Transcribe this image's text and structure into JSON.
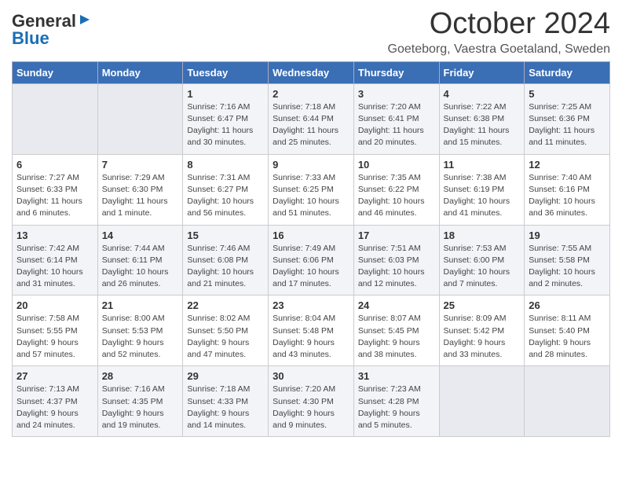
{
  "header": {
    "logo_general": "General",
    "logo_blue": "Blue",
    "title": "October 2024",
    "subtitle": "Goeteborg, Vaestra Goetaland, Sweden"
  },
  "days_of_week": [
    "Sunday",
    "Monday",
    "Tuesday",
    "Wednesday",
    "Thursday",
    "Friday",
    "Saturday"
  ],
  "weeks": [
    [
      {
        "day": "",
        "info": ""
      },
      {
        "day": "",
        "info": ""
      },
      {
        "day": "1",
        "info": "Sunrise: 7:16 AM\nSunset: 6:47 PM\nDaylight: 11 hours and 30 minutes."
      },
      {
        "day": "2",
        "info": "Sunrise: 7:18 AM\nSunset: 6:44 PM\nDaylight: 11 hours and 25 minutes."
      },
      {
        "day": "3",
        "info": "Sunrise: 7:20 AM\nSunset: 6:41 PM\nDaylight: 11 hours and 20 minutes."
      },
      {
        "day": "4",
        "info": "Sunrise: 7:22 AM\nSunset: 6:38 PM\nDaylight: 11 hours and 15 minutes."
      },
      {
        "day": "5",
        "info": "Sunrise: 7:25 AM\nSunset: 6:36 PM\nDaylight: 11 hours and 11 minutes."
      }
    ],
    [
      {
        "day": "6",
        "info": "Sunrise: 7:27 AM\nSunset: 6:33 PM\nDaylight: 11 hours and 6 minutes."
      },
      {
        "day": "7",
        "info": "Sunrise: 7:29 AM\nSunset: 6:30 PM\nDaylight: 11 hours and 1 minute."
      },
      {
        "day": "8",
        "info": "Sunrise: 7:31 AM\nSunset: 6:27 PM\nDaylight: 10 hours and 56 minutes."
      },
      {
        "day": "9",
        "info": "Sunrise: 7:33 AM\nSunset: 6:25 PM\nDaylight: 10 hours and 51 minutes."
      },
      {
        "day": "10",
        "info": "Sunrise: 7:35 AM\nSunset: 6:22 PM\nDaylight: 10 hours and 46 minutes."
      },
      {
        "day": "11",
        "info": "Sunrise: 7:38 AM\nSunset: 6:19 PM\nDaylight: 10 hours and 41 minutes."
      },
      {
        "day": "12",
        "info": "Sunrise: 7:40 AM\nSunset: 6:16 PM\nDaylight: 10 hours and 36 minutes."
      }
    ],
    [
      {
        "day": "13",
        "info": "Sunrise: 7:42 AM\nSunset: 6:14 PM\nDaylight: 10 hours and 31 minutes."
      },
      {
        "day": "14",
        "info": "Sunrise: 7:44 AM\nSunset: 6:11 PM\nDaylight: 10 hours and 26 minutes."
      },
      {
        "day": "15",
        "info": "Sunrise: 7:46 AM\nSunset: 6:08 PM\nDaylight: 10 hours and 21 minutes."
      },
      {
        "day": "16",
        "info": "Sunrise: 7:49 AM\nSunset: 6:06 PM\nDaylight: 10 hours and 17 minutes."
      },
      {
        "day": "17",
        "info": "Sunrise: 7:51 AM\nSunset: 6:03 PM\nDaylight: 10 hours and 12 minutes."
      },
      {
        "day": "18",
        "info": "Sunrise: 7:53 AM\nSunset: 6:00 PM\nDaylight: 10 hours and 7 minutes."
      },
      {
        "day": "19",
        "info": "Sunrise: 7:55 AM\nSunset: 5:58 PM\nDaylight: 10 hours and 2 minutes."
      }
    ],
    [
      {
        "day": "20",
        "info": "Sunrise: 7:58 AM\nSunset: 5:55 PM\nDaylight: 9 hours and 57 minutes."
      },
      {
        "day": "21",
        "info": "Sunrise: 8:00 AM\nSunset: 5:53 PM\nDaylight: 9 hours and 52 minutes."
      },
      {
        "day": "22",
        "info": "Sunrise: 8:02 AM\nSunset: 5:50 PM\nDaylight: 9 hours and 47 minutes."
      },
      {
        "day": "23",
        "info": "Sunrise: 8:04 AM\nSunset: 5:48 PM\nDaylight: 9 hours and 43 minutes."
      },
      {
        "day": "24",
        "info": "Sunrise: 8:07 AM\nSunset: 5:45 PM\nDaylight: 9 hours and 38 minutes."
      },
      {
        "day": "25",
        "info": "Sunrise: 8:09 AM\nSunset: 5:42 PM\nDaylight: 9 hours and 33 minutes."
      },
      {
        "day": "26",
        "info": "Sunrise: 8:11 AM\nSunset: 5:40 PM\nDaylight: 9 hours and 28 minutes."
      }
    ],
    [
      {
        "day": "27",
        "info": "Sunrise: 7:13 AM\nSunset: 4:37 PM\nDaylight: 9 hours and 24 minutes."
      },
      {
        "day": "28",
        "info": "Sunrise: 7:16 AM\nSunset: 4:35 PM\nDaylight: 9 hours and 19 minutes."
      },
      {
        "day": "29",
        "info": "Sunrise: 7:18 AM\nSunset: 4:33 PM\nDaylight: 9 hours and 14 minutes."
      },
      {
        "day": "30",
        "info": "Sunrise: 7:20 AM\nSunset: 4:30 PM\nDaylight: 9 hours and 9 minutes."
      },
      {
        "day": "31",
        "info": "Sunrise: 7:23 AM\nSunset: 4:28 PM\nDaylight: 9 hours and 5 minutes."
      },
      {
        "day": "",
        "info": ""
      },
      {
        "day": "",
        "info": ""
      }
    ]
  ]
}
